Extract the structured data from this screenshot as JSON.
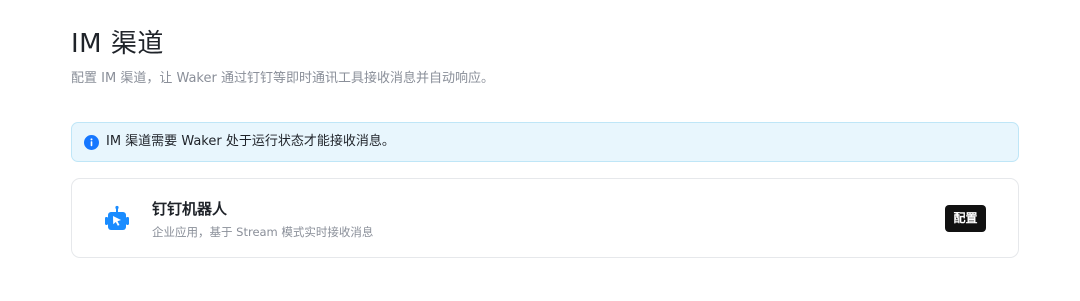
{
  "header": {
    "title": "IM 渠道",
    "description": "配置 IM 渠道，让 Waker 通过钉钉等即时通讯工具接收消息并自动响应。"
  },
  "notice": {
    "icon": "info-icon",
    "text": "IM 渠道需要 Waker 处于运行状态才能接收消息。",
    "color": "#1677ff"
  },
  "channels": [
    {
      "icon": "dingtalk-robot-icon",
      "name": "钉钉机器人",
      "description": "企业应用，基于 Stream 模式实时接收消息",
      "action_label": "配置",
      "icon_color": "#1a8cff"
    }
  ]
}
